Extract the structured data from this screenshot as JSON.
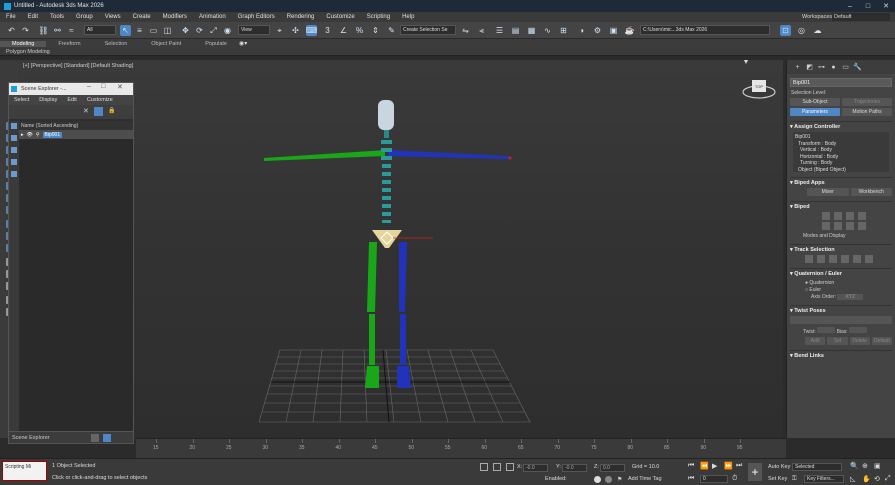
{
  "app": {
    "title": "Untitled - Autodesk 3ds Max 2026",
    "colors": {
      "accent": "#4f86c6",
      "titlebar": "#1f2a38",
      "viewport_bg": "#333333"
    }
  },
  "menu": [
    "File",
    "Edit",
    "Tools",
    "Group",
    "Views",
    "Create",
    "Modifiers",
    "Animation",
    "Graph Editors",
    "Rendering",
    "Customize",
    "Scripting",
    "Help"
  ],
  "workspace": {
    "label": "Workspaces:",
    "value": "Default"
  },
  "toolbar": {
    "filter_value": "All",
    "view_value": "View",
    "selection_set_placeholder": "Create Selection Se",
    "path": "C:\\Users\\mic...3ds Max 2026"
  },
  "ribbon": {
    "tabs": [
      "Modeling",
      "Freeform",
      "Selection",
      "Object Paint",
      "Populate"
    ],
    "active_tab": "Modeling",
    "sub_label": "Polygon Modeling"
  },
  "viewport": {
    "label": "[+] [Perspective] [Standard] [Default Shading]",
    "gizmo_label": "TOP"
  },
  "scene_explorer": {
    "title": "Scene Explorer -...",
    "menu": [
      "Select",
      "Display",
      "Edit",
      "Customize"
    ],
    "column_header": "Name (Sorted Ascending)",
    "rows": [
      {
        "name": "Bip001"
      }
    ],
    "footer_label": "Scene Explorer"
  },
  "command_panel": {
    "object_name": "Bip001",
    "selection_level_label": "Selection Level:",
    "buttons_row1": [
      "Sub-Object",
      "Trajectories"
    ],
    "buttons_row2": [
      "Parameters",
      "Motion Paths"
    ],
    "rollouts": {
      "assign_controller": "Assign Controller",
      "biped_apps": "Biped Apps",
      "biped": "Biped",
      "track_selection": "Track Selection",
      "quaternion_euler": "Quaternion / Euler",
      "twist_poses": "Twist Poses",
      "bend_links": "Bend Links"
    },
    "controller_list": [
      "Bip001",
      "Transform : Body",
      "Vertical : Body",
      "Horizontal : Body",
      "Turning : Body",
      "Object (Biped Object)"
    ],
    "biped_apps_buttons": [
      "Mixer",
      "Workbench"
    ],
    "biped_modes_label": "Modes and Display",
    "quaternion_label": "Quaternion",
    "euler_label": "Euler",
    "axis_order_label": "Axis Order:",
    "axis_order_value": "XYZ",
    "twist_label": "Twist:",
    "bias_label": "Bias:",
    "twist_buttons": [
      "Add",
      "Set",
      "Delete",
      "Default"
    ]
  },
  "timeline": {
    "ticks": [
      "15",
      "20",
      "25",
      "30",
      "35",
      "40",
      "45",
      "50",
      "55",
      "60",
      "65",
      "70",
      "75",
      "80",
      "85",
      "90",
      "95"
    ]
  },
  "status": {
    "maxscript_text": "Scripting Mi",
    "objects_selected": "1 Object Selected",
    "prompt": "Click or click-and-drag to select objects",
    "x_label": "X:",
    "x_value": "-0.0",
    "y_label": "Y:",
    "y_value": "-0.0",
    "z_label": "Z:",
    "z_value": "0.0",
    "grid": "Grid = 10.0",
    "add_time_tag": "Add Time Tag",
    "enabled_label": "Enabled:",
    "auto_key": "Auto Key",
    "set_key": "Set Key",
    "key_mode_value": "Selected",
    "key_filters": "Key Filters...",
    "frame_value": "0"
  }
}
